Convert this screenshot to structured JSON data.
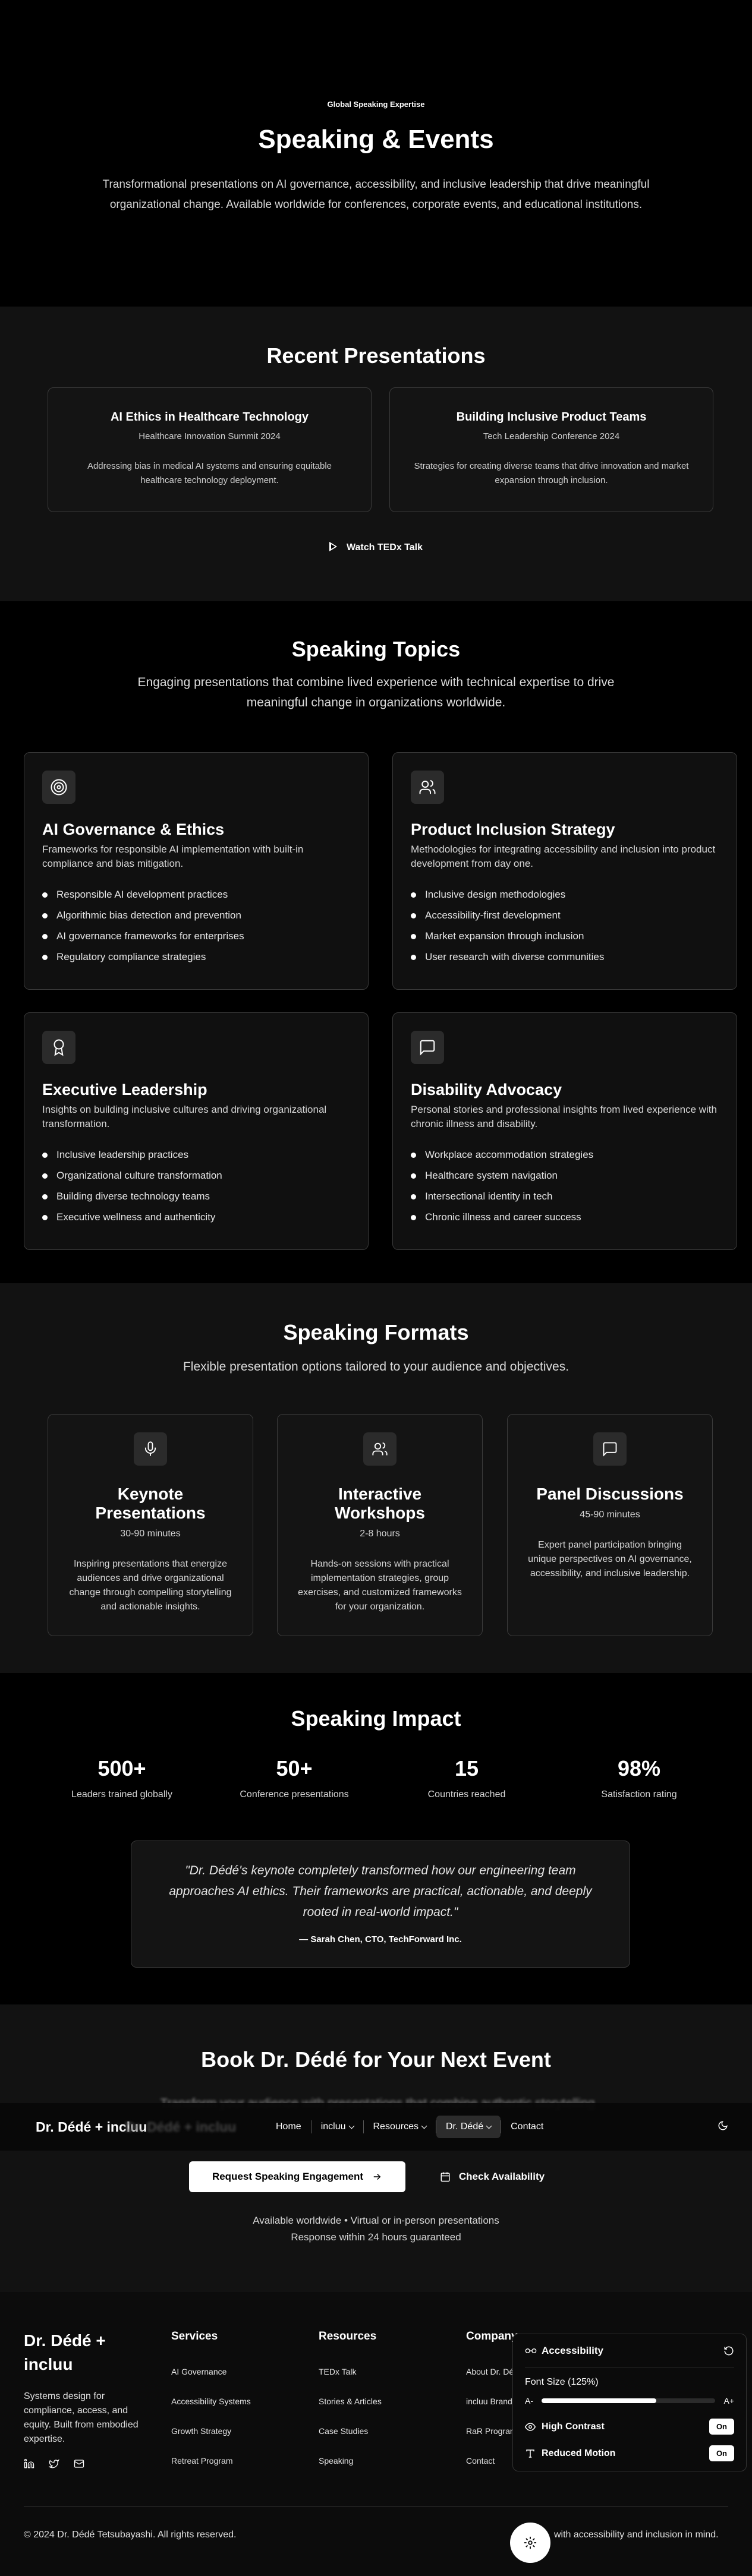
{
  "hero": {
    "eyebrow": "Global Speaking Expertise",
    "title": "Speaking & Events",
    "subtitle": "Transformational presentations on AI governance, accessibility, and inclusive leadership that drive meaningful organizational change. Available worldwide for conferences, corporate events, and educational institutions."
  },
  "recent": {
    "title": "Recent Presentations",
    "cards": [
      {
        "title": "AI Ethics in Healthcare Technology",
        "event": "Healthcare Innovation Summit 2024",
        "desc": "Addressing bias in medical AI systems and ensuring equitable healthcare technology deployment."
      },
      {
        "title": "Building Inclusive Product Teams",
        "event": "Tech Leadership Conference 2024",
        "desc": "Strategies for creating diverse teams that drive innovation and market expansion through inclusion."
      }
    ],
    "tedx_label": "Watch TEDx Talk"
  },
  "topics": {
    "title": "Speaking Topics",
    "subtitle": "Engaging presentations that combine lived experience with technical expertise to drive meaningful change in organizations worldwide.",
    "cards": [
      {
        "icon": "target-icon",
        "title": "AI Governance & Ethics",
        "desc": "Frameworks for responsible AI implementation with built-in compliance and bias mitigation.",
        "items": [
          "Responsible AI development practices",
          "Algorithmic bias detection and prevention",
          "AI governance frameworks for enterprises",
          "Regulatory compliance strategies"
        ]
      },
      {
        "icon": "users-icon",
        "title": "Product Inclusion Strategy",
        "desc": "Methodologies for integrating accessibility and inclusion into product development from day one.",
        "items": [
          "Inclusive design methodologies",
          "Accessibility-first development",
          "Market expansion through inclusion",
          "User research with diverse communities"
        ]
      },
      {
        "icon": "award-icon",
        "title": "Executive Leadership",
        "desc": "Insights on building inclusive cultures and driving organizational transformation.",
        "items": [
          "Inclusive leadership practices",
          "Organizational culture transformation",
          "Building diverse technology teams",
          "Executive wellness and authenticity"
        ]
      },
      {
        "icon": "message-icon",
        "title": "Disability Advocacy",
        "desc": "Personal stories and professional insights from lived experience with chronic illness and disability.",
        "items": [
          "Workplace accommodation strategies",
          "Healthcare system navigation",
          "Intersectional identity in tech",
          "Chronic illness and career success"
        ]
      }
    ]
  },
  "formats": {
    "title": "Speaking Formats",
    "subtitle": "Flexible presentation options tailored to your audience and objectives.",
    "cards": [
      {
        "icon": "microphone-icon",
        "title": "Keynote Presentations",
        "duration": "30-90 minutes",
        "desc": "Inspiring presentations that energize audiences and drive organizational change through compelling storytelling and actionable insights."
      },
      {
        "icon": "users-icon",
        "title": "Interactive Workshops",
        "duration": "2-8 hours",
        "desc": "Hands-on sessions with practical implementation strategies, group exercises, and customized frameworks for your organization."
      },
      {
        "icon": "message-icon",
        "title": "Panel Discussions",
        "duration": "45-90 minutes",
        "desc": "Expert panel participation bringing unique perspectives on AI governance, accessibility, and inclusive leadership."
      }
    ]
  },
  "impact": {
    "title": "Speaking Impact",
    "stats": [
      {
        "value": "500+",
        "label": "Leaders trained globally"
      },
      {
        "value": "50+",
        "label": "Conference presentations"
      },
      {
        "value": "15",
        "label": "Countries reached"
      },
      {
        "value": "98%",
        "label": "Satisfaction rating"
      }
    ],
    "quote": "\"Dr. Dédé's keynote completely transformed how our engineering team approaches AI ethics. Their frameworks are practical, actionable, and deeply rooted in real-world impact.\"",
    "author": "— Sarah Chen, CTO, TechForward Inc."
  },
  "book": {
    "title": "Book Dr. Dédé for Your Next Event",
    "subtitle": "Transform your audience with presentations that combine authentic storytelling",
    "primary_label": "Request Speaking Engagement",
    "secondary_label": "Check Availability",
    "avail_line1": "Available worldwide • Virtual or in-person presentations",
    "avail_line2": "Response within 24 hours guaranteed"
  },
  "nav": {
    "brand": "Dr. Dédé + incluu",
    "items": [
      {
        "label": "Home",
        "dropdown": false,
        "active": false
      },
      {
        "label": "incluu",
        "dropdown": true,
        "active": false
      },
      {
        "label": "Resources",
        "dropdown": true,
        "active": false
      },
      {
        "label": "Dr. Dédé",
        "dropdown": true,
        "active": true
      },
      {
        "label": "Contact",
        "dropdown": false,
        "active": false
      }
    ]
  },
  "footer": {
    "brand": "Dr. Dédé + incluu",
    "desc": "Systems design for compliance, access, and equity. Built from embodied expertise.",
    "columns": [
      {
        "title": "Services",
        "links": [
          "AI Governance",
          "Accessibility Systems",
          "Growth Strategy",
          "Retreat Program"
        ]
      },
      {
        "title": "Resources",
        "links": [
          "TEDx Talk",
          "Stories & Articles",
          "Case Studies",
          "Speaking"
        ]
      },
      {
        "title": "Company",
        "links": [
          "About Dr. Dédé",
          "incluu Brand",
          "RaR Program",
          "Contact"
        ]
      }
    ],
    "copyright": "© 2024 Dr. Dédé Tetsubayashi. All rights reserved.",
    "tagline_visible": "with accessibility and inclusion in mind."
  },
  "accessibility": {
    "title": "Accessibility",
    "font_size_label": "Font Size (125%)",
    "decrease": "A-",
    "increase": "A+",
    "font_level": 0.66,
    "high_contrast_label": "High Contrast",
    "high_contrast_state": "On",
    "reduced_motion_label": "Reduced Motion",
    "reduced_motion_state": "On"
  },
  "colors": {
    "background": "#0a0a0a",
    "surface": "#141414",
    "border": "#3a3a3a",
    "accent": "#ffffff"
  }
}
